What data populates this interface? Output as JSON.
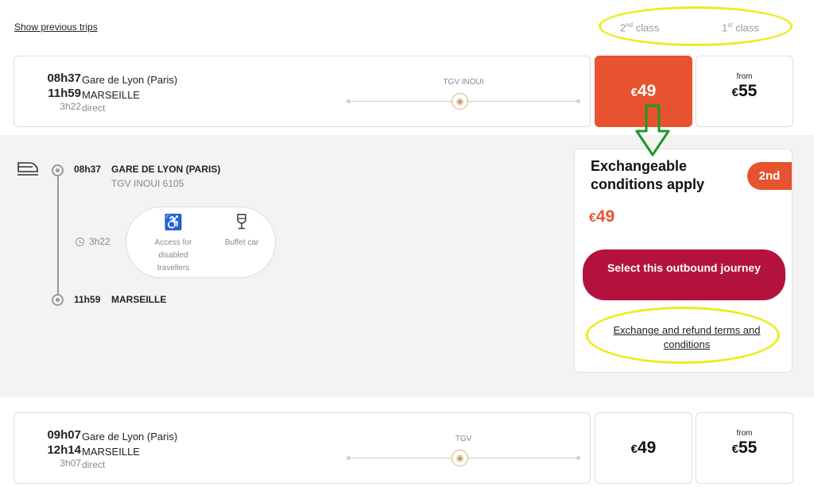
{
  "top": {
    "show_previous": "Show previous trips"
  },
  "class_tabs": {
    "second": {
      "num": "2",
      "sup": "nd",
      "label": "class"
    },
    "first": {
      "num": "1",
      "sup": "st",
      "label": "class"
    }
  },
  "trips": [
    {
      "depart_time": "08h37",
      "arrive_time": "11h59",
      "duration": "3h22",
      "from": "Gare de Lyon (Paris)",
      "to": "MARSEILLE",
      "type": "direct",
      "train": "TGV INOUI",
      "second_class": {
        "from_label": "",
        "currency": "€",
        "amount": "49"
      },
      "first_class": {
        "from_label": "from",
        "currency": "€",
        "amount": "55"
      }
    },
    {
      "depart_time": "09h07",
      "arrive_time": "12h14",
      "duration": "3h07",
      "from": "Gare de Lyon (Paris)",
      "to": "MARSEILLE",
      "type": "direct",
      "train": "TGV",
      "second_class": {
        "from_label": "",
        "currency": "€",
        "amount": "49"
      },
      "first_class": {
        "from_label": "from",
        "currency": "€",
        "amount": "55"
      }
    }
  ],
  "details": {
    "depart_time": "08h37",
    "depart_station": "GARE DE LYON (PARIS)",
    "train_number": "TGV INOUI 6105",
    "duration": "3h22",
    "arrive_time": "11h59",
    "arrive_station": "MARSEILLE",
    "services": [
      {
        "icon": "wheelchair-icon",
        "label": "Access for disabled travellers"
      },
      {
        "icon": "wine-glass-icon",
        "label": "Buffet car"
      }
    ]
  },
  "fare": {
    "title": "Exchangeable conditions apply",
    "badge": "2nd",
    "currency": "€",
    "amount": "49",
    "select_button": "Select this outbound journey",
    "terms_link": "Exchange and refund terms and conditions"
  },
  "colors": {
    "accent_orange": "#e8532f",
    "select_button": "#b3123f",
    "highlight_yellow": "#ecec1e",
    "arrow_green": "#1a9a2a"
  }
}
